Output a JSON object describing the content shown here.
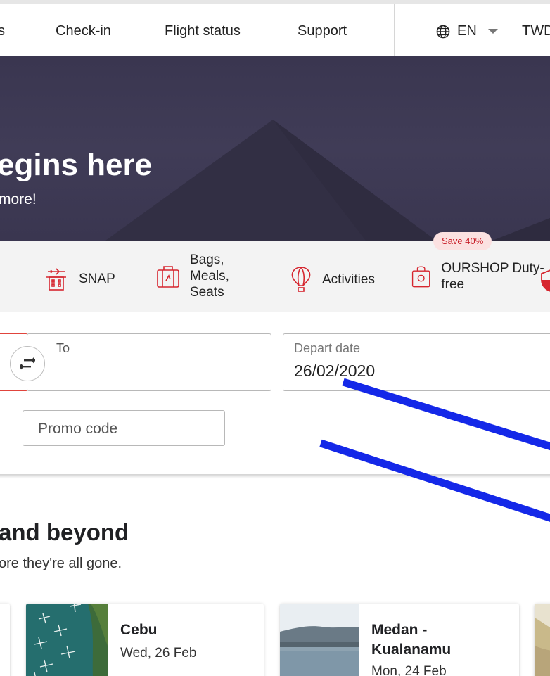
{
  "nav": {
    "fragment": "s",
    "items": [
      "Check-in",
      "Flight status",
      "Support"
    ],
    "language": "EN",
    "currency": "TWD"
  },
  "hero": {
    "title": "egins here",
    "subtitle": "more!"
  },
  "services": {
    "items": [
      {
        "label": "SNAP",
        "icon": "hotel-plane-icon"
      },
      {
        "label": "Bags, Meals, Seats",
        "icon": "luggage-icon"
      },
      {
        "label": "Activities",
        "icon": "hot-air-balloon-icon"
      },
      {
        "label": "OURSHOP Duty-free",
        "icon": "shopping-bag-icon"
      },
      {
        "label": "",
        "icon": "shield-icon"
      }
    ],
    "save_badge": "Save 40%"
  },
  "search": {
    "to_label": "To",
    "depart_label": "Depart date",
    "depart_value": "26/02/2020",
    "promo_placeholder": "Promo code"
  },
  "deals": {
    "title": "and beyond",
    "subtitle": "ore they're all gone.",
    "cards": [
      {
        "city": "Cebu",
        "date": "Wed, 26 Feb"
      },
      {
        "city": "Medan - Kualanamu",
        "date": "Mon, 24 Feb"
      }
    ]
  },
  "colors": {
    "brand_red": "#d6262f",
    "hero_bg": "#3c3852",
    "annotation_blue": "#1428e8"
  }
}
